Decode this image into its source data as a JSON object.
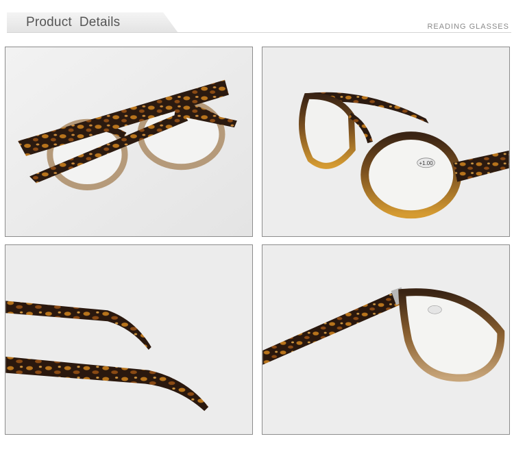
{
  "header": {
    "title": "Product  Details",
    "subtitle": "READING GLASSES"
  },
  "panels": [
    {
      "name": "glasses-folded-top-view"
    },
    {
      "name": "glasses-side-angle-view",
      "lens_label": "+1.00"
    },
    {
      "name": "temple-arms-detail"
    },
    {
      "name": "hinge-closeup-view"
    }
  ],
  "colors": {
    "tortoise_dark": "#2b1a10",
    "tortoise_amber": "#b8741c",
    "lens_frame_beige": "#b59a7a",
    "lens_frame_amber": "#c48a2a",
    "background_gray": "#ececec"
  }
}
